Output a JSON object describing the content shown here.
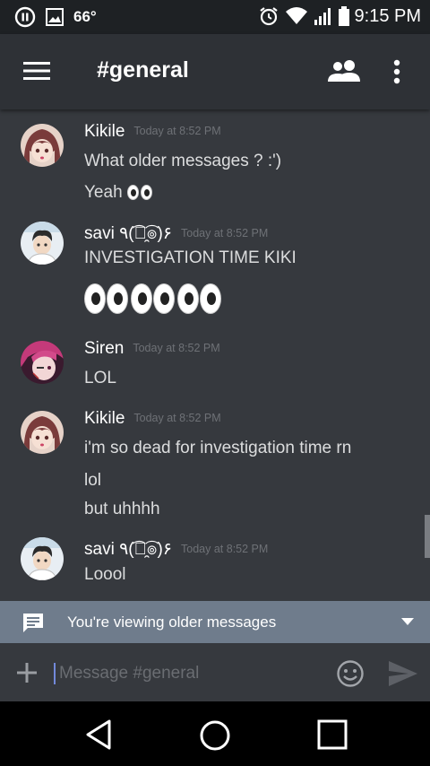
{
  "status_bar": {
    "temperature": "66°",
    "time": "9:15 PM"
  },
  "app_bar": {
    "channel_title": "#general",
    "icons": [
      "hamburger-menu-icon",
      "members-icon",
      "overflow-menu-icon"
    ]
  },
  "messages": [
    {
      "author": "Kikile",
      "timestamp": "Today at 8:52 PM",
      "lines": [
        "What older messages ? :')",
        "Yeah"
      ]
    },
    {
      "author": "savi ٩(͡๏̯͡๏)۶",
      "timestamp": "Today at 8:52 PM",
      "lines": [
        "INVESTIGATION TIME KIKI"
      ]
    },
    {
      "author": "Siren",
      "timestamp": "Today at 8:52 PM",
      "lines": [
        "LOL"
      ]
    },
    {
      "author": "Kikile",
      "timestamp": "Today at 8:52 PM",
      "lines": [
        "i'm so dead for investigation time rn",
        "lol",
        "but uhhhh"
      ]
    },
    {
      "author": "savi ٩(͡๏̯͡๏)۶",
      "timestamp": "Today at 8:52 PM",
      "lines": [
        "Loool"
      ]
    }
  ],
  "banner": {
    "text": "You're viewing older messages"
  },
  "composer": {
    "placeholder": "Message #general"
  },
  "colors": {
    "background": "#36393e",
    "app_bar": "#2e3136",
    "banner": "#6f7c8c",
    "accent": "#7289da"
  }
}
